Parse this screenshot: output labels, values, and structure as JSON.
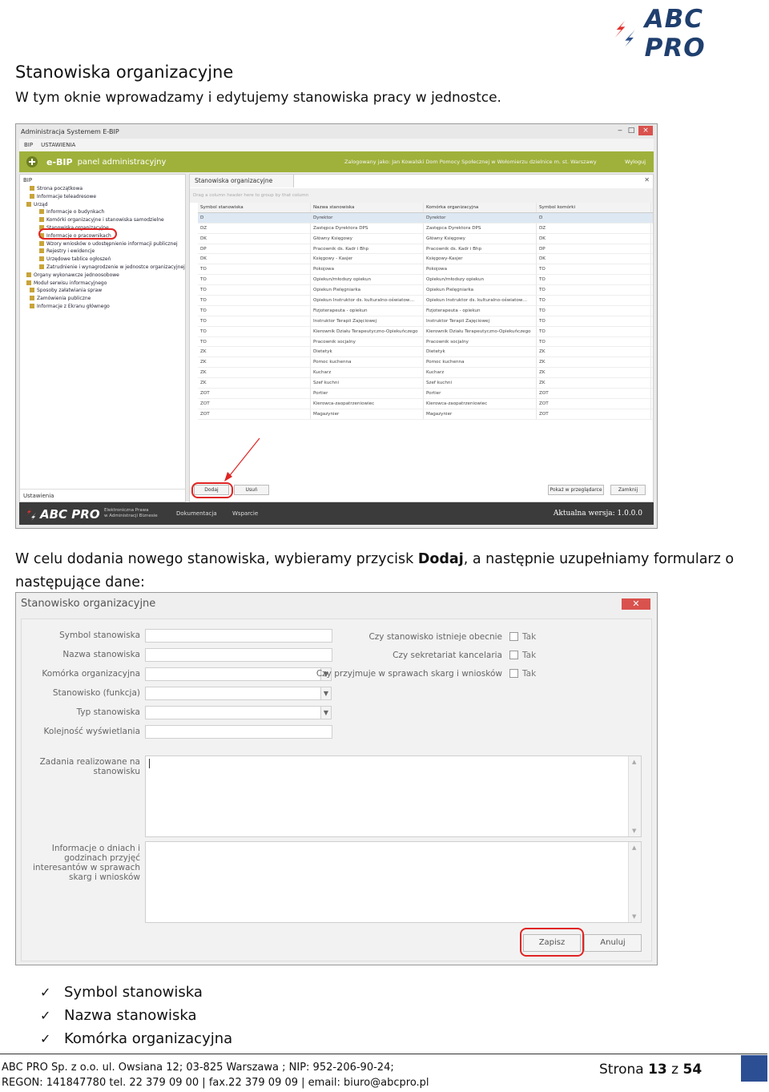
{
  "logo": {
    "text": "ABC PRO"
  },
  "heading": "Stanowiska organizacyjne",
  "intro": "W tym oknie wprowadzamy i edytujemy stanowiska pracy w jednostce.",
  "screenshot1": {
    "window_title": "Administracja Systemem E-BIP",
    "menu": [
      "BIP",
      "USTAWIENIA"
    ],
    "header_brand": "e-BIP",
    "header_sub": "panel administracyjny",
    "logged_in": "Zalogowany jako: Jan Kowalski  Dom Pomocy Społecznej w Wołomierzu dzielnice m. st. Warszawy",
    "logout": "Wyloguj",
    "left_title": "BIP",
    "tree": [
      "Strona początkowa",
      "Informacje teleadresowe",
      "Urząd",
      "Informacje o budynkach",
      "Komórki organizacyjne i stanowiska samodzielne",
      "Stanowiska organizacyjne",
      "Informacje o pracownikach",
      "Wzory wniosków o udostępnienie informacji publicznej",
      "Rejestry i ewidencje",
      "Urzędowe tablice ogłoszeń",
      "Zatrudnienie i wynagrodzenie w jednostce organizacyjnej",
      "Organy wykonawcze jednoosobowe",
      "Moduł serwisu informacyjnego",
      "Sposoby załatwiania spraw",
      "Zamówienia publiczne",
      "Informacje z Ekranu głównego"
    ],
    "left_footer": "Ustawienia",
    "tab": "Stanowiska organizacyjne",
    "group_hint": "Drag a column header here to group by that column",
    "columns": [
      "Symbol stanowiska",
      "Nazwa stanowiska",
      "Komórka organizacyjna",
      "Symbol komórki"
    ],
    "rows": [
      [
        "D",
        "Dyrektor",
        "Dyrektor",
        "D"
      ],
      [
        "DZ",
        "Zastępca Dyrektora DPS",
        "Zastępca Dyrektora DPS",
        "DZ"
      ],
      [
        "DK",
        "Główny Księgowy",
        "Główny Księgowy",
        "DK"
      ],
      [
        "DP",
        "Pracownik ds. Kadr i Bhp",
        "Pracownik ds. Kadr i Bhp",
        "DP"
      ],
      [
        "DK",
        "Księgowy - Kasjer",
        "Księgowy-Kasjer",
        "DK"
      ],
      [
        "TO",
        "Pokojowa",
        "Pokojowa",
        "TO"
      ],
      [
        "TO",
        "Opiekun/młodszy opiekun",
        "Opiekun/młodszy opiekun",
        "TO"
      ],
      [
        "TO",
        "Opiekun Pielęgniarka",
        "Opiekun Pielęgniarka",
        "TO"
      ],
      [
        "TO",
        "Opiekun Instruktor ds. kulturalno-oświatow…",
        "Opiekun Instruktor ds. kulturalno-oświatow…",
        "TO"
      ],
      [
        "TO",
        "Fizjoterapeuta - opiekun",
        "Fizjoterapeuta - opiekun",
        "TO"
      ],
      [
        "TO",
        "Instruktor Terapii Zajęciowej",
        "Instruktor Terapii Zajęciowej",
        "TO"
      ],
      [
        "TO",
        "Kierownik Działu Terapeutyczno-Opiekuńczego",
        "Kierownik Działu Terapeutyczno-Opiekuńczego",
        "TO"
      ],
      [
        "TO",
        "Pracownik socjalny",
        "Pracownik socjalny",
        "TO"
      ],
      [
        "ZK",
        "Dietetyk",
        "Dietetyk",
        "ZK"
      ],
      [
        "ZK",
        "Pomoc kuchenna",
        "Pomoc kuchenna",
        "ZK"
      ],
      [
        "ZK",
        "Kucharz",
        "Kucharz",
        "ZK"
      ],
      [
        "ZK",
        "Szef kuchni",
        "Szef kuchni",
        "ZK"
      ],
      [
        "ZOT",
        "Portier",
        "Portier",
        "ZOT"
      ],
      [
        "ZOT",
        "Kierowca-zaopatrzeniowiec",
        "Kierowca-zaopatrzeniowiec",
        "ZOT"
      ],
      [
        "ZOT",
        "Magazynier",
        "Magazynier",
        "ZOT"
      ]
    ],
    "buttons": {
      "add": "Dodaj",
      "delete": "Usuń",
      "preview": "Pokaż w przeglądarce",
      "close": "Zamknij"
    },
    "footer": {
      "logo": "ABC PRO",
      "sub1": "Elektroniczna Prawa",
      "sub2": "w Administracji Biznesie",
      "doc": "Dokumentacja",
      "support": "Wsparcie",
      "version": "Aktualna wersja: 1.0.0.0"
    }
  },
  "paragraph2_a": "W celu dodania nowego stanowiska, wybieramy przycisk ",
  "paragraph2_bold": "Dodaj",
  "paragraph2_b": ", a następnie uzupełniamy formularz o następujące dane:",
  "screenshot2": {
    "title": "Stanowisko organizacyjne",
    "close": "✕",
    "fields": [
      "Symbol stanowiska",
      "Nazwa stanowiska",
      "Komórka organizacyjna",
      "Stanowisko (funkcja)",
      "Typ stanowiska",
      "Kolejność wyświetlania"
    ],
    "tasks_label_1": "Zadania realizowane na",
    "tasks_label_2": "stanowisku",
    "info_label_1": "Informacje o dniach i",
    "info_label_2": "godzinach przyjęć",
    "info_label_3": "interesantów w sprawach",
    "info_label_4": "skarg i wniosków",
    "checks": [
      "Czy stanowisko istnieje obecnie",
      "Czy sekretariat kancelaria",
      "Czy przyjmuje w sprawach skarg i wniosków"
    ],
    "check_value": "Tak",
    "save": "Zapisz",
    "cancel": "Anuluj"
  },
  "checklist": [
    "Symbol stanowiska",
    "Nazwa stanowiska",
    "Komórka organizacyjna"
  ],
  "footer": {
    "line1": "ABC PRO Sp. z o.o. ul. Owsiana 12;  03-825 Warszawa ; NIP: 952-206-90-24;",
    "line2": "REGON: 141847780 tel. 22 379 09 00 | fax.22 379 09 09 | email: biuro@abcpro.pl",
    "page_word": "Strona",
    "page": "13",
    "of_word": "z",
    "total": "54"
  }
}
